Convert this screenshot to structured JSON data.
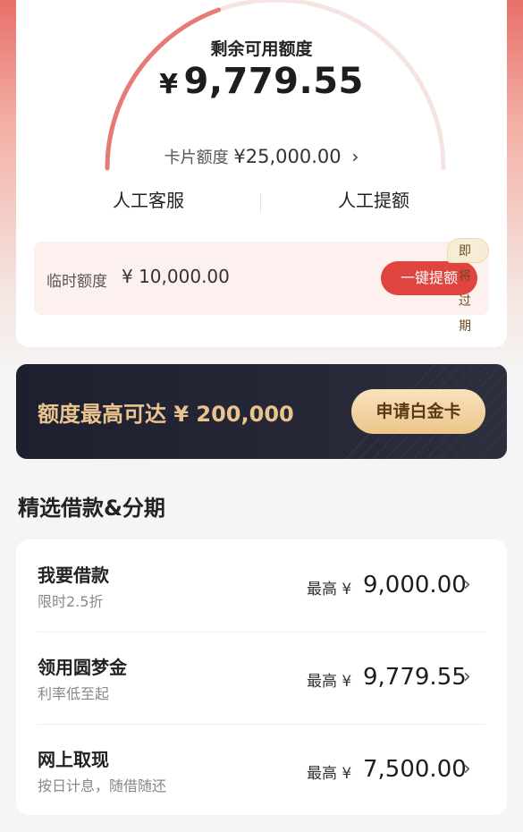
{
  "quota": {
    "remaining_label": "剩余可用额度",
    "currency": "¥",
    "remaining_amount": "9,779.55",
    "card_limit_label": "卡片额度",
    "card_limit_value": "¥25,000.00",
    "used_fraction": 0.61
  },
  "services": {
    "left_label": "人工客服",
    "right_label": "人工提额"
  },
  "temporary": {
    "label": "临时额度",
    "value": "¥ 10,000.00",
    "button_label": "一键提额",
    "badge": "即将过期"
  },
  "banner": {
    "text": "额度最高可达 ¥ 200,000",
    "button_label": "申请白金卡"
  },
  "loans": {
    "section_title": "精选借款&分期",
    "items": [
      {
        "name": "我要借款",
        "sub": "限时2.5折",
        "max_label": "最高 ¥",
        "amount": "9,000.00"
      },
      {
        "name": "领用圆梦金",
        "sub": "利率低至起",
        "max_label": "最高 ¥",
        "amount": "9,779.55"
      },
      {
        "name": "网上取现",
        "sub": "按日计息，随借随还",
        "max_label": "最高 ¥",
        "amount": "7,500.00"
      }
    ]
  },
  "colors": {
    "accent_red": "#e0443f",
    "gold": "#e9c48e",
    "banner_bg": "#1e1f2e"
  }
}
